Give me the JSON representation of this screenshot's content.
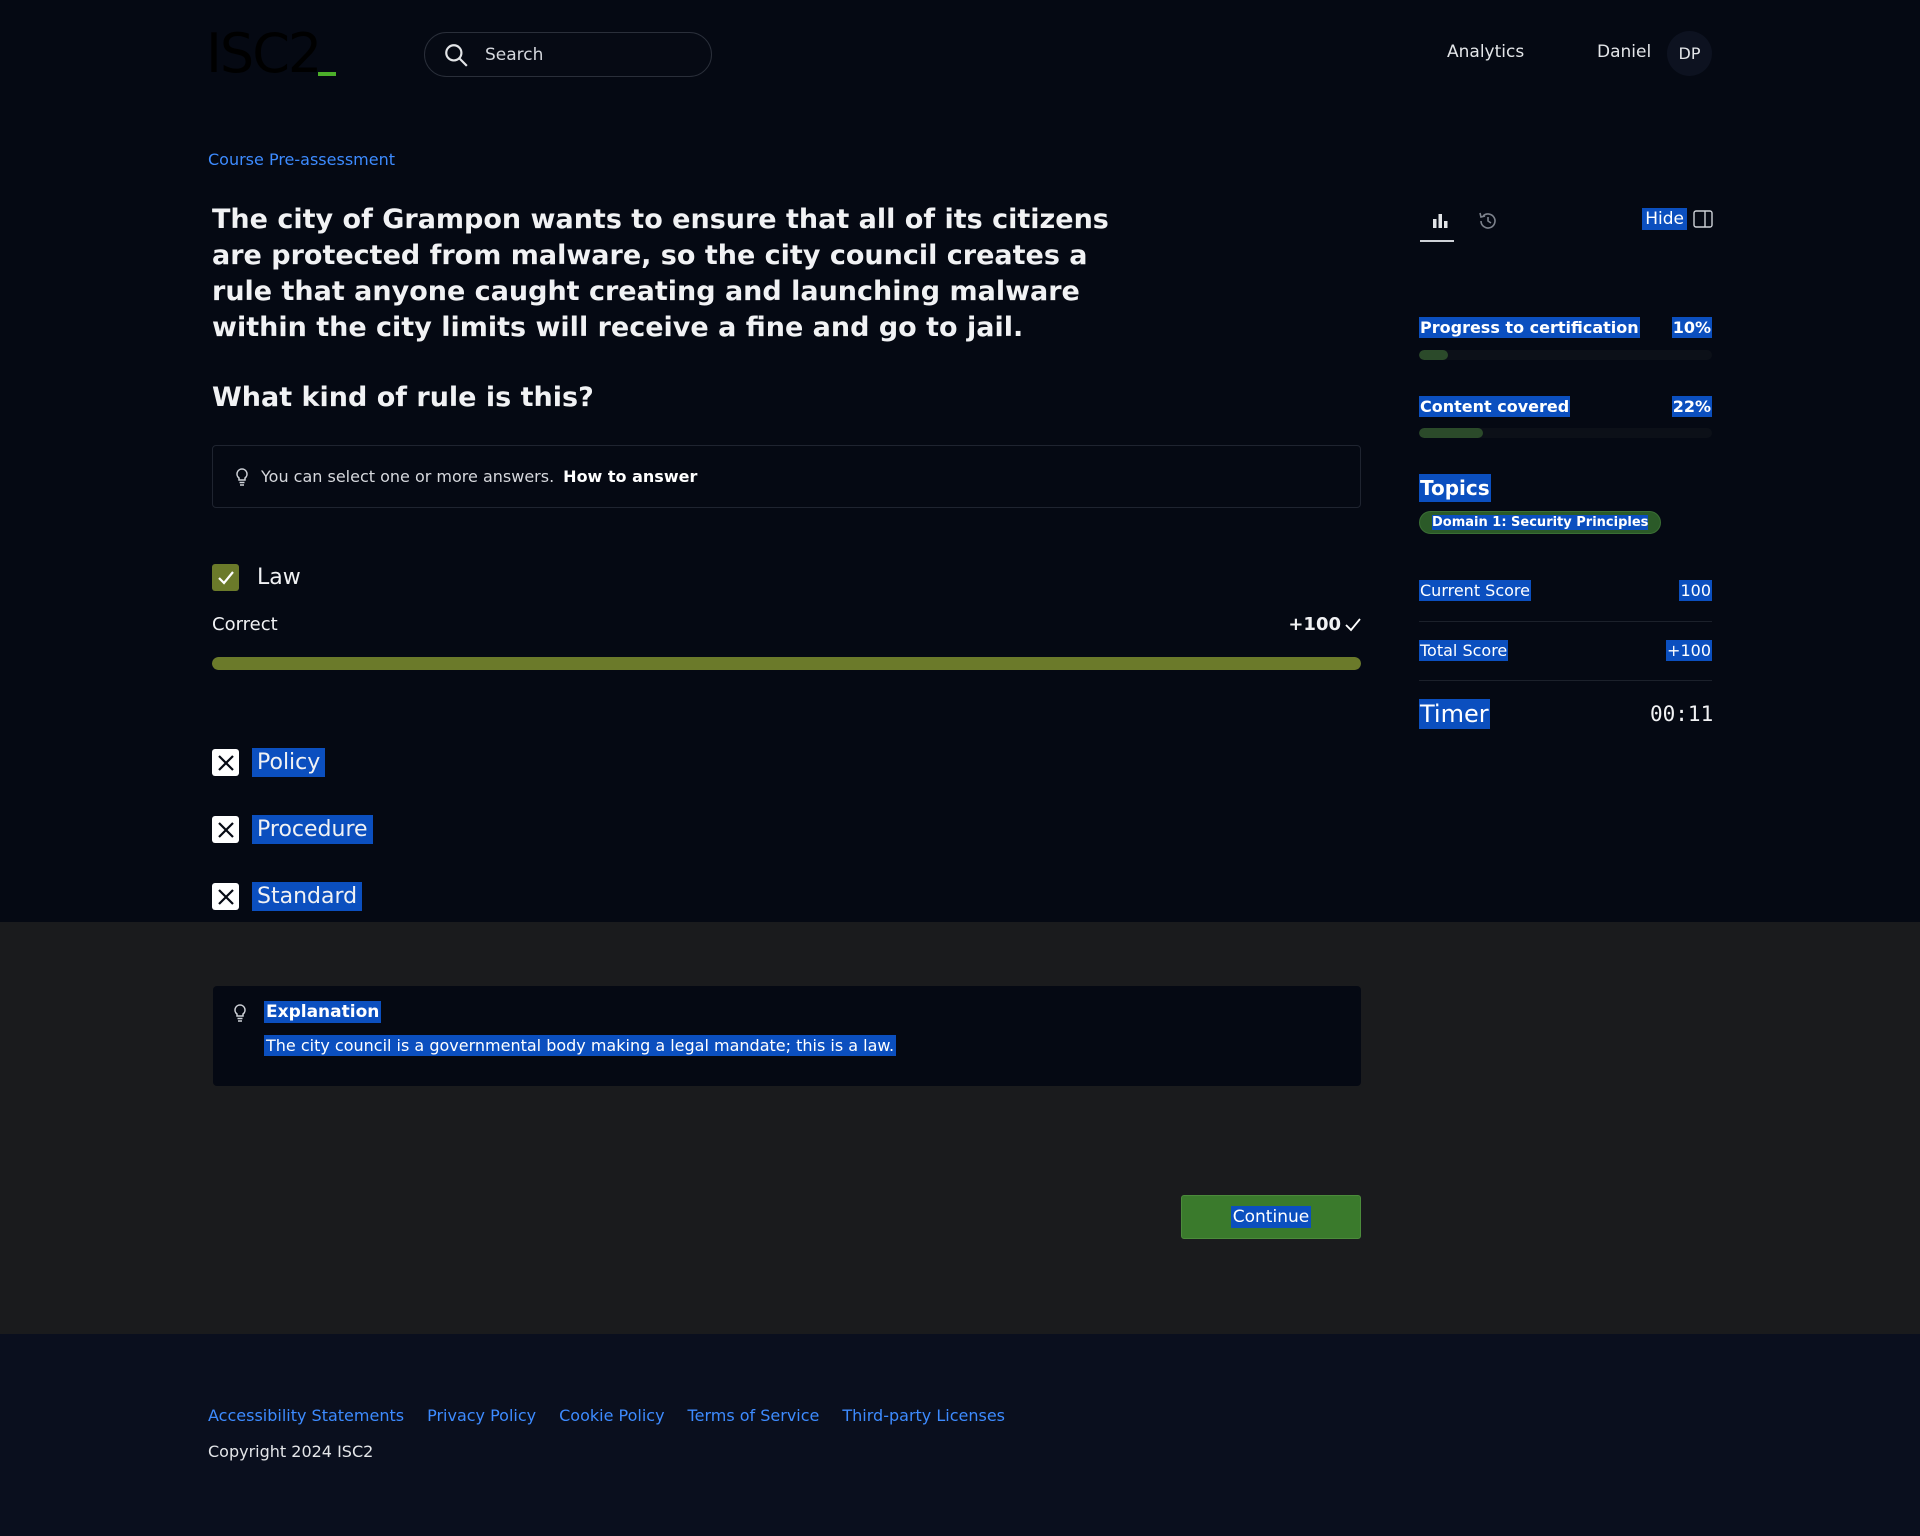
{
  "header": {
    "logo_text": "ISC2",
    "search_placeholder": "Search",
    "nav_analytics": "Analytics",
    "user_name": "Daniel",
    "avatar_initials": "DP"
  },
  "assessment": {
    "breadcrumb": "Course Pre-assessment",
    "question": "The city of Grampon wants to ensure that all of its citizens are protected from malware, so the city council creates a rule that anyone caught creating and launching malware within the city limits will receive a fine and go to jail.",
    "prompt": "What kind of rule is this?",
    "hint": "You can select one or more answers.",
    "how_to_answer": "How to answer",
    "options": [
      {
        "label": "Law",
        "state": "correct-selected"
      },
      {
        "label": "Policy",
        "state": "incorrect"
      },
      {
        "label": "Procedure",
        "state": "incorrect"
      },
      {
        "label": "Standard",
        "state": "incorrect"
      }
    ],
    "result_label": "Correct",
    "result_points": "+100",
    "result_progress": 1.0
  },
  "sidebar": {
    "hide_label": "Hide",
    "progress_label": "Progress to certification",
    "progress_value": "10%",
    "progress_fraction": 0.1,
    "content_label": "Content covered",
    "content_value": "22%",
    "content_fraction": 0.22,
    "topics_label": "Topics",
    "topic_chip": "Domain 1: Security Principles",
    "current_score_label": "Current Score",
    "current_score_value": "100",
    "total_score_label": "Total Score",
    "total_score_value": "+100",
    "timer_label": "Timer",
    "timer_value": "00:11"
  },
  "explanation": {
    "title": "Explanation",
    "body": "The city council is a governmental body making a legal mandate; this is a law."
  },
  "actions": {
    "continue_label": "Continue"
  },
  "footer": {
    "links": [
      "Accessibility Statements",
      "Privacy Policy",
      "Cookie Policy",
      "Terms of Service",
      "Third-party Licenses"
    ],
    "copyright": "Copyright 2024 ISC2"
  },
  "colors": {
    "accent_link": "#3d8bff",
    "correct_green": "#6b7a2a",
    "button_green": "#3a7a2c",
    "selection_blue": "#0b4fbf"
  }
}
